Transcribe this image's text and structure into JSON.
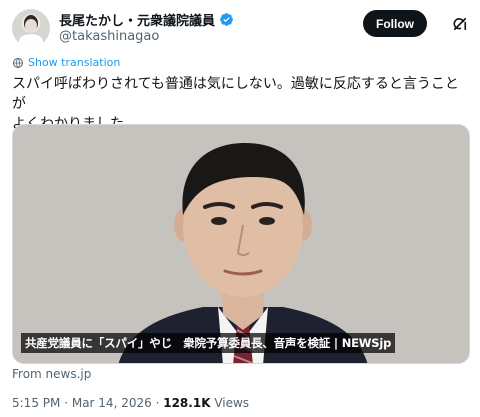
{
  "author": {
    "display_name": "長尾たかし・元衆議院議員",
    "handle": "@takashinagao",
    "verified": true,
    "avatar_icon": "avatar-photo"
  },
  "actions": {
    "follow_label": "Follow",
    "grok_icon": "grok-icon"
  },
  "translation": {
    "label": "Show translation",
    "icon": "translate-icon"
  },
  "tweet": {
    "text_line1": "スパイ呼ばわりされても普通は気にしない。過敏に反応すると言うことが",
    "text_line2": "よくわかりました。"
  },
  "media": {
    "caption": "共産党議員に「スパイ」やじ　衆院予算委員長、音声を検証 | NEWSjp",
    "background_color": "#c6c3be"
  },
  "card": {
    "source": "From news.jp"
  },
  "meta": {
    "time": "5:15 PM",
    "separator": "·",
    "date": "Mar 14, 2026",
    "views_count": "128.1K",
    "views_label": "Views"
  },
  "colors": {
    "accent": "#1d9bf0",
    "text": "#0f1419",
    "secondary": "#536471",
    "follow_bg": "#0f1419"
  }
}
